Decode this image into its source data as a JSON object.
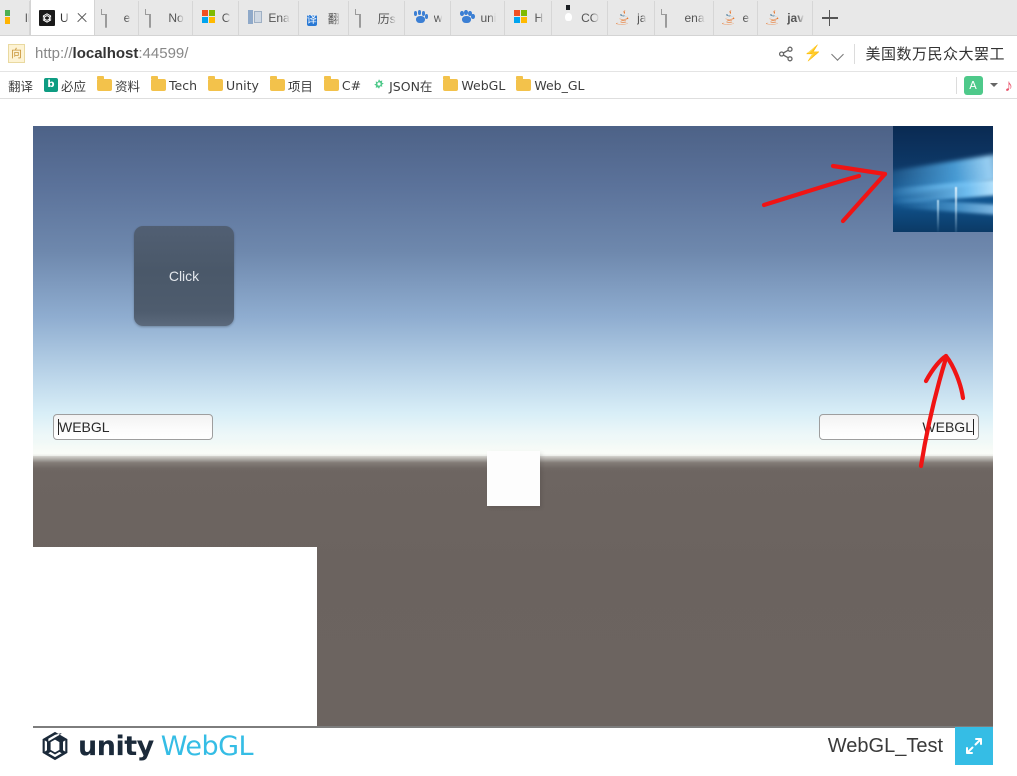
{
  "browser": {
    "tabs": [
      {
        "title": "ll",
        "icon": "multicolor-icon",
        "active": false,
        "partial": true
      },
      {
        "title": "U",
        "icon": "unity-icon",
        "active": true,
        "partial": false
      },
      {
        "title": "e",
        "icon": "document-icon",
        "active": false,
        "partial": false
      },
      {
        "title": "No",
        "icon": "document-icon",
        "active": false,
        "partial": false
      },
      {
        "title": "C",
        "icon": "microsoft-icon",
        "active": false,
        "partial": false
      },
      {
        "title": "Ena",
        "icon": "book-icon",
        "active": false,
        "partial": false
      },
      {
        "title": "翻",
        "icon": "translate-icon",
        "active": false,
        "partial": false
      },
      {
        "title": "历s",
        "icon": "document-icon",
        "active": false,
        "partial": false
      },
      {
        "title": "w",
        "icon": "baidu-paw-icon",
        "active": false,
        "partial": false
      },
      {
        "title": "uni",
        "icon": "baidu-paw-icon",
        "active": false,
        "partial": false
      },
      {
        "title": "H",
        "icon": "microsoft-icon",
        "active": false,
        "partial": false
      },
      {
        "title": "CO",
        "icon": "github-icon",
        "active": false,
        "partial": false
      },
      {
        "title": "ja",
        "icon": "java-icon",
        "active": false,
        "partial": false
      },
      {
        "title": "ena",
        "icon": "document-icon",
        "active": false,
        "partial": false
      },
      {
        "title": "e",
        "icon": "java-icon",
        "active": false,
        "partial": false
      },
      {
        "title": "jav",
        "icon": "java-icon",
        "active": false,
        "partial": false
      }
    ],
    "new_tab_label": "new-tab",
    "close_tab_label": "close",
    "address": {
      "site_icon_glyph": "向",
      "url_scheme": "http://",
      "url_host": "localhost",
      "url_rest": ":44599/"
    },
    "address_actions": {
      "share": "share-icon",
      "bolt": "⚡",
      "chevron": "chevron-down-icon",
      "news_headline": "美国数万民众大罢工"
    },
    "bookmarks": {
      "items": [
        {
          "label": "翻译",
          "icon": "folder-icon"
        },
        {
          "label": "必应",
          "icon": "bing-icon"
        },
        {
          "label": "资料",
          "icon": "folder-icon"
        },
        {
          "label": "Tech",
          "icon": "folder-icon"
        },
        {
          "label": "Unity",
          "icon": "folder-icon"
        },
        {
          "label": "项目",
          "icon": "folder-icon"
        },
        {
          "label": "C#",
          "icon": "folder-icon"
        },
        {
          "label": "JSON在",
          "icon": "json-icon"
        },
        {
          "label": "WebGL",
          "icon": "folder-icon"
        },
        {
          "label": "Web_GL",
          "icon": "folder-icon"
        }
      ],
      "extensions": {
        "translate_glyph": "A",
        "caret": "chevron-down-icon",
        "red_glyph": "♪"
      }
    }
  },
  "webgl_player": {
    "canvas": {
      "click_button_label": "Click",
      "input_left_value": "WEBGL",
      "input_right_value": "WEBGL",
      "sky_top_color": "#4d6287",
      "sky_horizon_color": "#f0f8f5",
      "ground_color": "#6b635f",
      "annotation_color": "#f01414",
      "annotation_count": 2,
      "windows_thumbnail": "windows-desktop-screenshot"
    },
    "footer": {
      "logo_word": "unity",
      "logo_suffix": "WebGL",
      "build_title": "WebGL_Test",
      "fullscreen_icon": "fullscreen-icon",
      "accent_color": "#35bde5"
    }
  }
}
